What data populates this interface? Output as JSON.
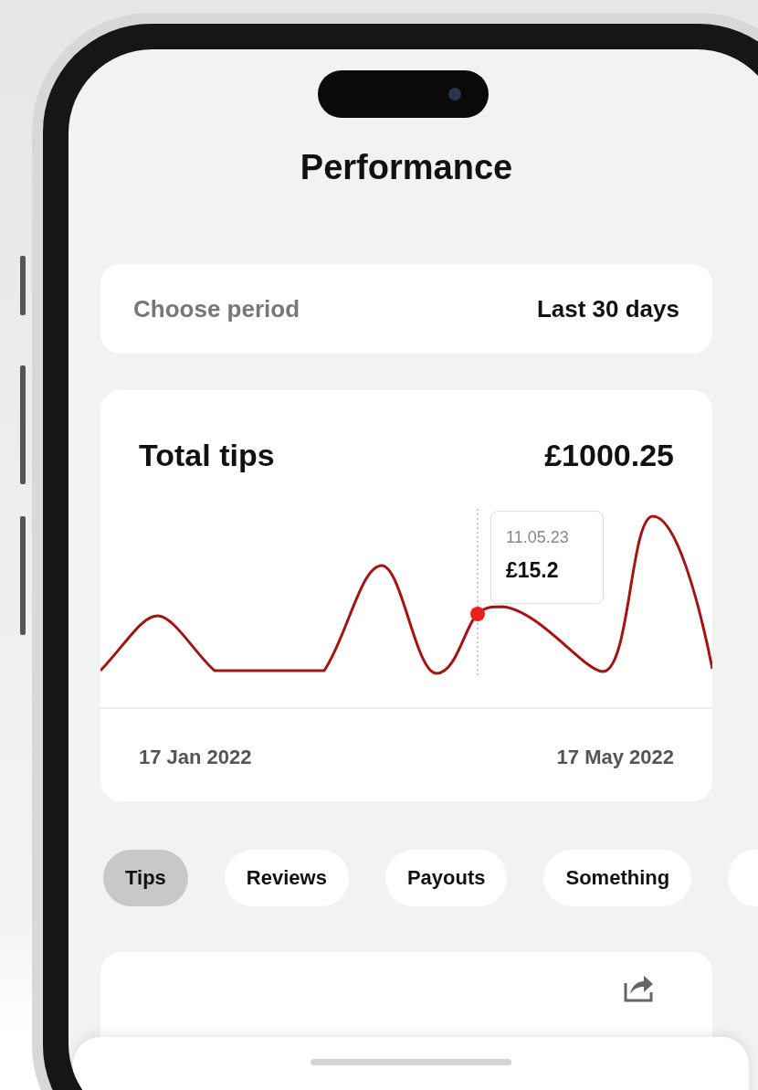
{
  "title": "Performance",
  "period": {
    "label": "Choose period",
    "value": "Last 30 days"
  },
  "tips_card": {
    "title": "Total tips",
    "total": "£1000.25",
    "tooltip": {
      "date": "11.05.23",
      "value": "£15.2"
    },
    "start_date": "17 Jan 2022",
    "end_date": "17 May 2022"
  },
  "tabs": [
    {
      "label": "Tips",
      "selected": true
    },
    {
      "label": "Reviews",
      "selected": false
    },
    {
      "label": "Payouts",
      "selected": false
    },
    {
      "label": "Something",
      "selected": false
    }
  ]
}
